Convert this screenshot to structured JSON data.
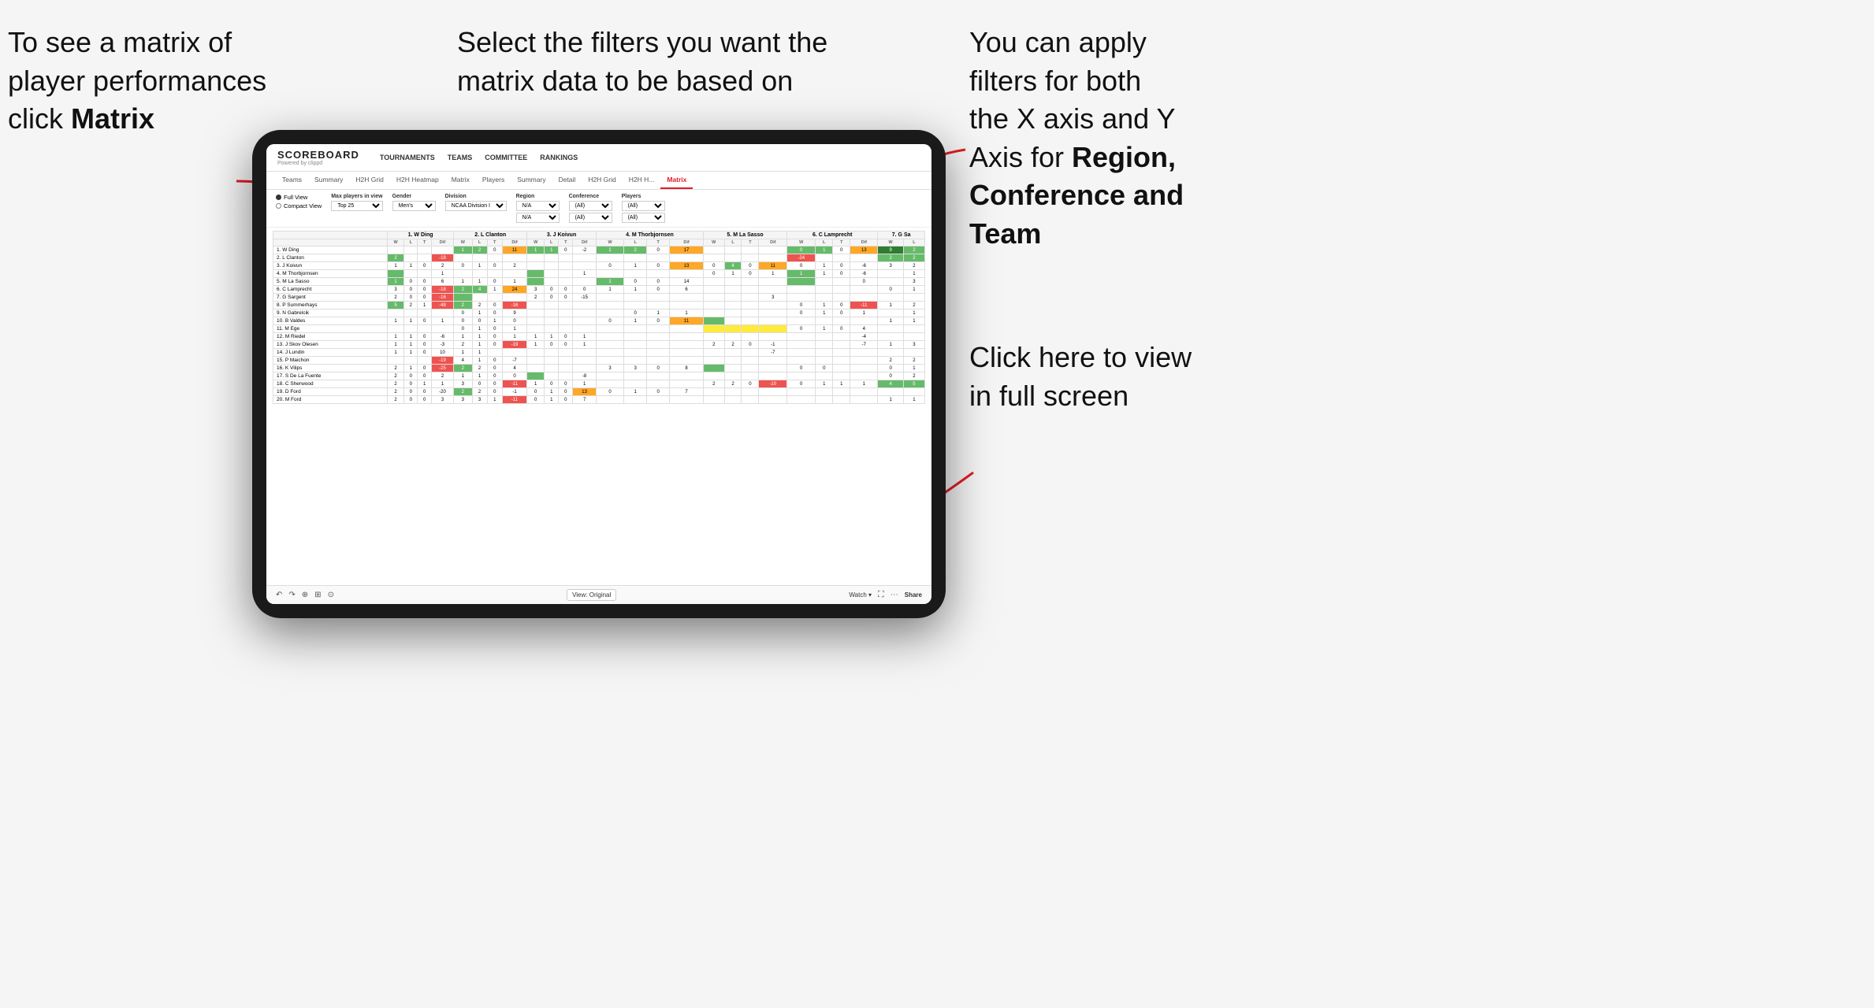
{
  "annotations": {
    "top_left": {
      "line1": "To see a matrix of",
      "line2": "player performances",
      "line3_prefix": "click ",
      "line3_bold": "Matrix"
    },
    "top_center": {
      "text": "Select the filters you want the matrix data to be based on"
    },
    "top_right": {
      "line1": "You  can apply",
      "line2": "filters for both",
      "line3": "the X axis and Y",
      "line4_prefix": "Axis for ",
      "line4_bold": "Region,",
      "line5_bold": "Conference and",
      "line6_bold": "Team"
    },
    "bottom_right": {
      "line1": "Click here to view",
      "line2": "in full screen"
    }
  },
  "nav": {
    "logo_title": "SCOREBOARD",
    "logo_sub": "Powered by clippd",
    "links": [
      "TOURNAMENTS",
      "TEAMS",
      "COMMITTEE",
      "RANKINGS"
    ]
  },
  "sub_nav": {
    "items": [
      "Teams",
      "Summary",
      "H2H Grid",
      "H2H Heatmap",
      "Matrix",
      "Players",
      "Summary",
      "Detail",
      "H2H Grid",
      "H2H H...",
      "Matrix"
    ]
  },
  "filters": {
    "view_options": [
      "Full View",
      "Compact View"
    ],
    "max_players_label": "Max players in view",
    "max_players_value": "Top 25",
    "gender_label": "Gender",
    "gender_value": "Men's",
    "division_label": "Division",
    "division_value": "NCAA Division I",
    "region_label": "Region",
    "region_values": [
      "N/A",
      "N/A"
    ],
    "conference_label": "Conference",
    "conference_values": [
      "(All)",
      "(All)"
    ],
    "players_label": "Players",
    "players_values": [
      "(All)",
      "(All)"
    ]
  },
  "column_headers": [
    {
      "name": "1. W Ding"
    },
    {
      "name": "2. L Clanton"
    },
    {
      "name": "3. J Koivun"
    },
    {
      "name": "4. M Thorbjornsen"
    },
    {
      "name": "5. M La Sasso"
    },
    {
      "name": "6. C Lamprecht"
    },
    {
      "name": "7. G Sa"
    }
  ],
  "rows": [
    {
      "name": "1. W Ding"
    },
    {
      "name": "2. L Clanton"
    },
    {
      "name": "3. J Koivun"
    },
    {
      "name": "4. M Thorbjornsen"
    },
    {
      "name": "5. M La Sasso"
    },
    {
      "name": "6. C Lamprecht"
    },
    {
      "name": "7. G Sargent"
    },
    {
      "name": "8. P Summerhays"
    },
    {
      "name": "9. N Gabrelcik"
    },
    {
      "name": "10. B Valdes"
    },
    {
      "name": "11. M Ege"
    },
    {
      "name": "12. M Riedel"
    },
    {
      "name": "13. J Skov Olesen"
    },
    {
      "name": "14. J Lundin"
    },
    {
      "name": "15. P Maichon"
    },
    {
      "name": "16. K Vilips"
    },
    {
      "name": "17. S De La Fuente"
    },
    {
      "name": "18. C Sherwood"
    },
    {
      "name": "19. D Ford"
    },
    {
      "name": "20. M Ford"
    }
  ],
  "bottom_bar": {
    "view_original": "View: Original",
    "watch": "Watch",
    "share": "Share"
  }
}
